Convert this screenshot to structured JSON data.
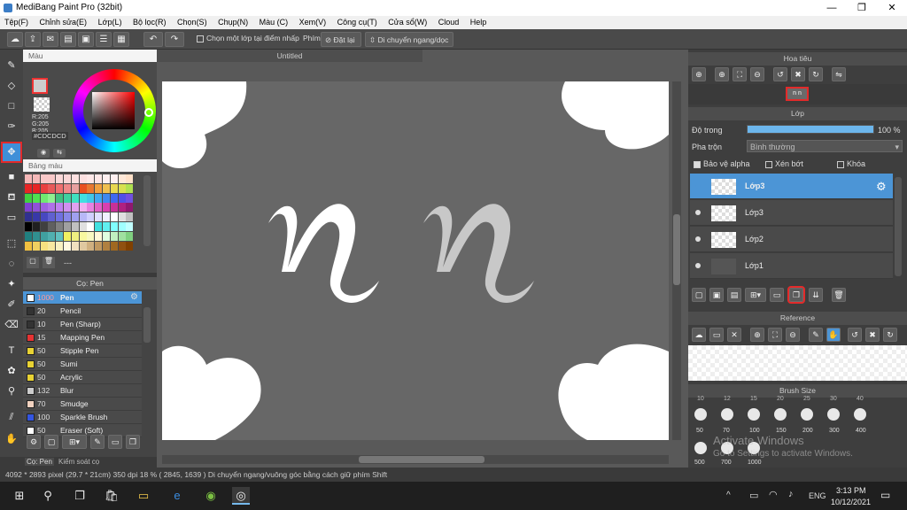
{
  "window": {
    "title": "MediBang Paint Pro (32bit)"
  },
  "menu": [
    "Tệp(F)",
    "Chỉnh sửa(E)",
    "Lớp(L)",
    "Bộ lọc(R)",
    "Chọn(S)",
    "Chụp(N)",
    "Màu (C)",
    "Xem(V)",
    "Công cụ(T)",
    "Cửa sổ(W)",
    "Cloud",
    "Help"
  ],
  "toolbar": {
    "snap_checkbox": "Chọn một lớp tại điểm nhấp",
    "phim_label": "Phím",
    "reset_label": "Đặt lại",
    "move_hint_label": "Di chuyển ngang/dọc"
  },
  "color_panel": {
    "title": "Màu",
    "rgb_r": "R:205",
    "rgb_g": "G:205",
    "rgb_b": "B:205",
    "hex": "#CDCDCD",
    "palette_title": "Bảng màu",
    "palette_more": "---"
  },
  "document": {
    "tab": "Untitled"
  },
  "brush_panel": {
    "title": "Cọ: Pen",
    "tab_brush": "Cọ: Pen",
    "tab_control": "Kiểm soát cọ",
    "items": [
      {
        "size": "1000",
        "name": "Pen",
        "color": "#ffffff"
      },
      {
        "size": "20",
        "name": "Pencil",
        "color": "#333333"
      },
      {
        "size": "10",
        "name": "Pen (Sharp)",
        "color": "#333333"
      },
      {
        "size": "15",
        "name": "Mapping Pen",
        "color": "#e53333"
      },
      {
        "size": "50",
        "name": "Stipple Pen",
        "color": "#e8d233"
      },
      {
        "size": "50",
        "name": "Sumi",
        "color": "#e8d233"
      },
      {
        "size": "50",
        "name": "Acrylic",
        "color": "#e8d233"
      },
      {
        "size": "132",
        "name": "Blur",
        "color": "#cccccc"
      },
      {
        "size": "70",
        "name": "Smudge",
        "color": "#f2d2c0"
      },
      {
        "size": "100",
        "name": "Sparkle Brush",
        "color": "#3355e0"
      },
      {
        "size": "50",
        "name": "Eraser (Soft)",
        "color": "#ffffff"
      }
    ]
  },
  "navigator": {
    "title": "Hoa tiêu"
  },
  "layer_panel": {
    "title": "Lớp",
    "opacity_label": "Độ trong",
    "opacity_value": "100 %",
    "opacity": 1.0,
    "blend_label": "Pha trộn",
    "blend_value": "Bình thường",
    "protect_alpha": "Bảo vệ alpha",
    "clip": "Xén bớt",
    "lock": "Khóa",
    "layers": [
      "Lớp3",
      "Lớp3",
      "Lớp2",
      "Lớp1"
    ]
  },
  "reference_panel": {
    "title": "Reference"
  },
  "brush_size_panel": {
    "title": "Brush Size",
    "top_labels": [
      "10",
      "12",
      "15",
      "20",
      "25",
      "30",
      "40"
    ],
    "row1": [
      "50",
      "70",
      "100",
      "150",
      "200",
      "300",
      "400"
    ],
    "row2": [
      "500",
      "700",
      "1000"
    ]
  },
  "watermark": {
    "line1": "Activate Windows",
    "line2": "Go to Settings to activate Windows."
  },
  "status": {
    "size": "4092 * 2893 pixel",
    "cm": "(29.7 * 21cm)",
    "dpi": "350 dpi",
    "zoom": "18 %",
    "coords": "( 2845, 1639 )",
    "hint": "Di chuyển ngang/vuông góc bằng cách giữ phím Shift"
  },
  "taskbar": {
    "time": "3:13 PM",
    "date": "10/12/2021",
    "lang": "ENG"
  }
}
